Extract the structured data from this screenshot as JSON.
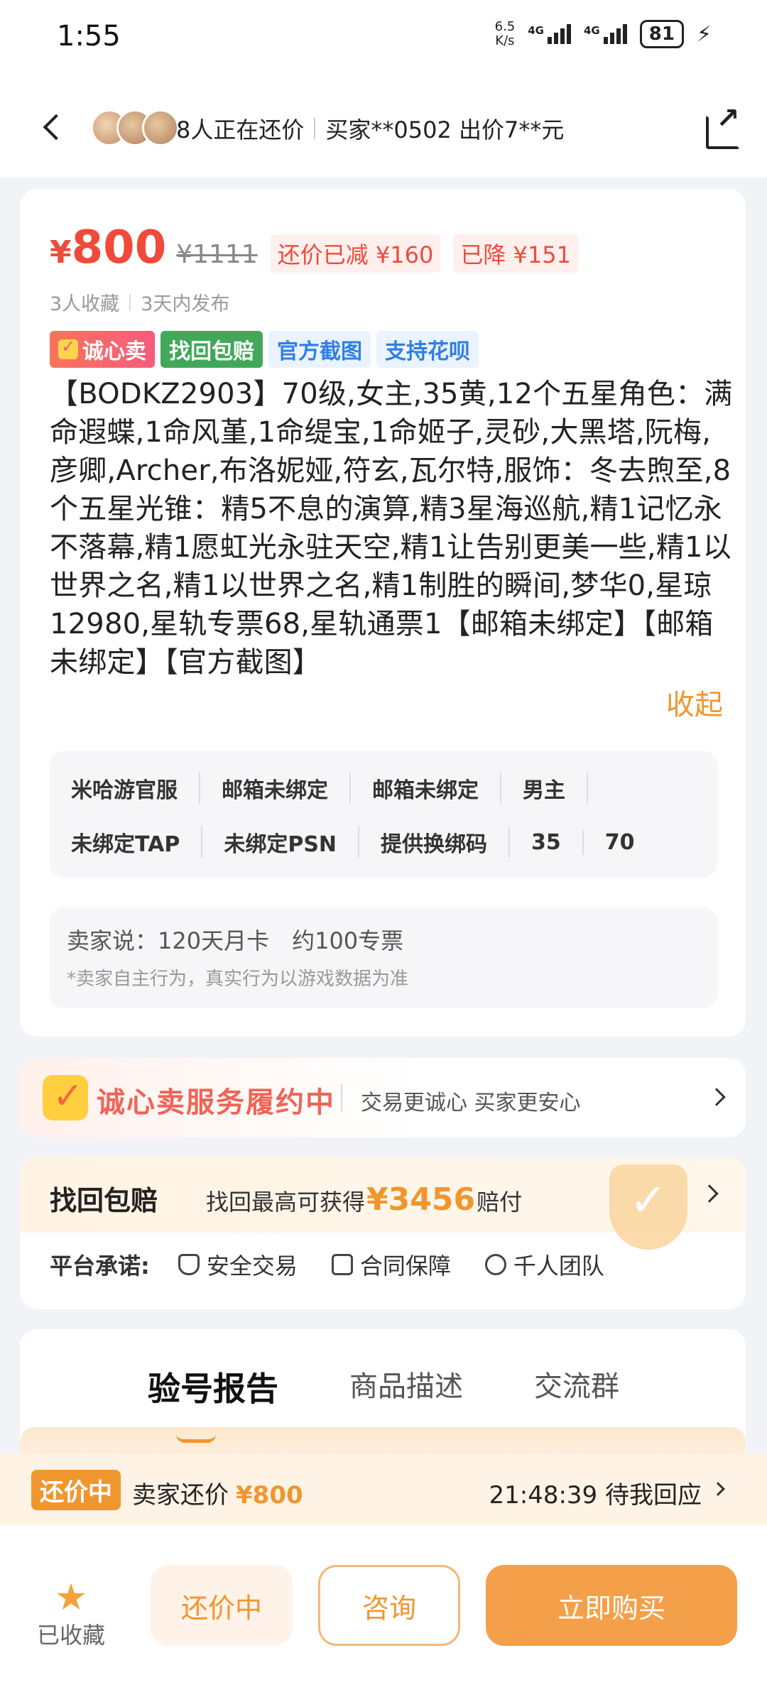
{
  "status_bar": {
    "time": "1:55",
    "net_speed_value": "6.5",
    "net_speed_unit": "K/s",
    "signal1_label": "4G",
    "signal2_label": "4G",
    "battery": "81"
  },
  "nav": {
    "activity_text": "8人正在还价",
    "latest_offer_text": "买家**0502 出价7**元"
  },
  "product": {
    "price": "800",
    "price_symbol": "¥",
    "original_price": "¥1111",
    "tag_bargain_reduced": "还价已减 ¥160",
    "tag_price_drop": "已降 ¥151",
    "favorites": "3人收藏",
    "published": "3天内发布",
    "badges": [
      "诚心卖",
      "找回包赔",
      "官方截图",
      "支持花呗"
    ],
    "description": "【BODKZ2903】70级,女主,35黄,12个五星角色：满命遐蝶,1命风堇,1命缇宝,1命姬子,灵砂,大黑塔,阮梅,彦卿,Archer,布洛妮娅,符玄,瓦尔特,服饰：冬去煦至,8个五星光锥：精5不息的演算,精3星海巡航,精1记忆永不落幕,精1愿虹光永驻天空,精1让告别更美一些,精1以世界之名,精1以世界之名,精1制胜的瞬间,梦华0,星琼12980,星轨专票68,星轨通票1【邮箱未绑定】【邮箱未绑定】【官方截图】",
    "collapse_label": "收起",
    "attributes_row1": [
      "米哈游官服",
      "邮箱未绑定",
      "邮箱未绑定",
      "男主"
    ],
    "attributes_row2": [
      "未绑定TAP",
      "未绑定PSN",
      "提供换绑码",
      "35",
      "70"
    ],
    "seller_says": "卖家说：120天月卡　约100专票",
    "seller_note": "*卖家自主行为，真实行为以游戏数据为准"
  },
  "service": {
    "title": "诚心卖服务履约中",
    "subtitle": "交易更诚心 买家更安心"
  },
  "guarantee": {
    "title": "找回包赔",
    "text_prefix": "找回最高可获得",
    "amount": "¥3456",
    "text_suffix": "赔付",
    "platform_label": "平台承诺:",
    "promises": [
      "安全交易",
      "合同保障",
      "千人团队"
    ]
  },
  "tabs": [
    "验号报告",
    "商品描述",
    "交流群"
  ],
  "bargain": {
    "badge": "还价中",
    "text": "卖家还价",
    "price": "¥800",
    "countdown": "21:48:39 待我回应"
  },
  "bottom": {
    "fav_label": "已收藏",
    "bargain_button": "还价中",
    "consult_button": "咨询",
    "buy_button": "立即购买"
  },
  "colors": {
    "accent_orange": "#f0962e",
    "price_red": "#f04a3a",
    "buy_button": "#f4a04a"
  }
}
